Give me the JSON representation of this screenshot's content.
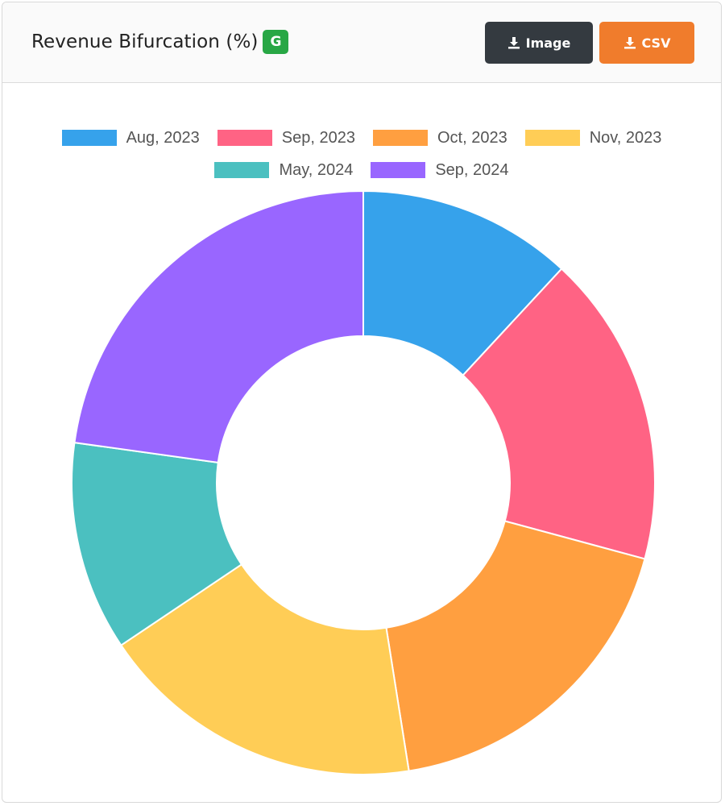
{
  "header": {
    "title": "Revenue Bifurcation (%)",
    "badge": "G",
    "image_button_label": "Image",
    "csv_button_label": "CSV"
  },
  "colors": {
    "badge": "#28a745",
    "image_button": "#343a40",
    "csv_button": "#f07c2c"
  },
  "chart_data": {
    "type": "pie",
    "donut": true,
    "title": "Revenue Bifurcation (%)",
    "legend_position": "top",
    "categories": [
      "Aug, 2023",
      "Sep, 2023",
      "Oct, 2023",
      "Nov, 2023",
      "May, 2024",
      "Sep, 2024"
    ],
    "values": [
      11.9,
      17.3,
      18.3,
      18.1,
      11.6,
      22.8
    ],
    "colors": [
      "#36a2eb",
      "#ff6384",
      "#ff9f40",
      "#ffcd56",
      "#4bc0c0",
      "#9966ff"
    ]
  }
}
